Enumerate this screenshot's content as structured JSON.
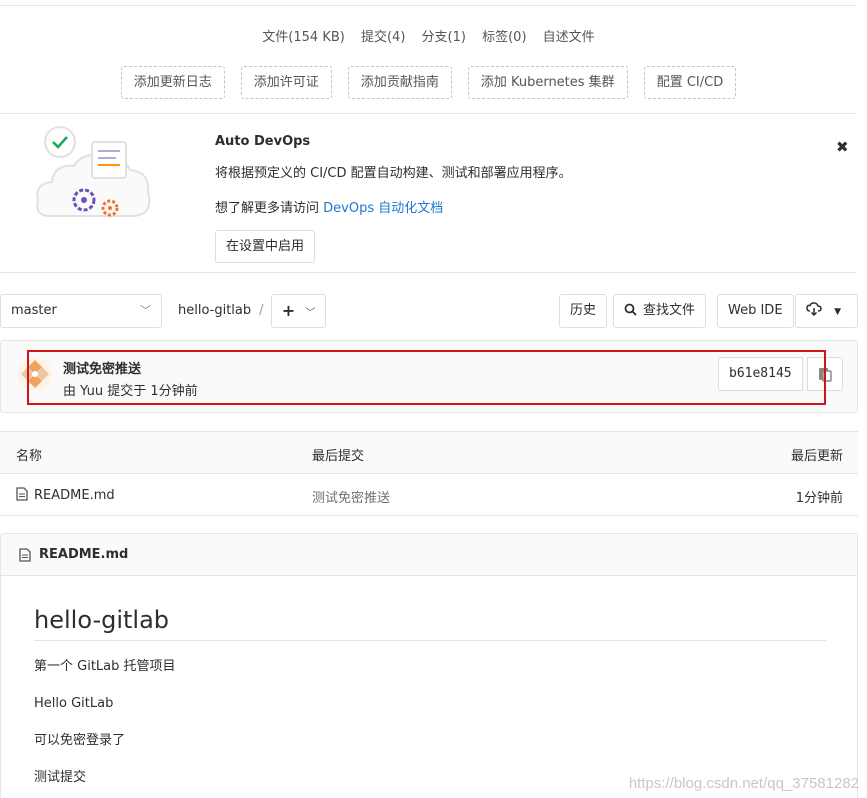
{
  "stats": {
    "files": "文件(154 KB)",
    "commits": "提交(4)",
    "branches": "分支(1)",
    "tags": "标签(0)",
    "readme": "自述文件"
  },
  "add_buttons": {
    "changelog": "添加更新日志",
    "license": "添加许可证",
    "contributing": "添加贡献指南",
    "kubernetes": "添加 Kubernetes 集群",
    "cicd": "配置 CI/CD"
  },
  "auto_devops": {
    "title": "Auto DevOps",
    "description": "将根据预定义的 CI/CD 配置自动构建、测试和部署应用程序。",
    "more_prefix": "想了解更多请访问 ",
    "more_link": "DevOps 自动化文档",
    "enable_button": "在设置中启用",
    "close_icon": "close-icon"
  },
  "tree": {
    "branch": "master",
    "project": "hello-gitlab",
    "separator": "/",
    "add_button": "+",
    "history": "历史",
    "find_file": "查找文件",
    "web_ide": "Web IDE"
  },
  "last_commit": {
    "title": "测试免密推送",
    "meta": "由 Yuu 提交于 1分钟前",
    "sha": "b61e8145",
    "highlight_color": "#d0151a"
  },
  "file_table": {
    "headers": [
      "名称",
      "最后提交",
      "最后更新"
    ],
    "rows": [
      {
        "name": "README.md",
        "commit": "测试免密推送",
        "updated": "1分钟前"
      }
    ]
  },
  "readme": {
    "filename": "README.md",
    "heading": "hello-gitlab",
    "paragraphs": [
      "第一个 GitLab 托管项目",
      "Hello GitLab",
      "可以免密登录了",
      "测试提交"
    ]
  },
  "watermark": "https://blog.csdn.net/qq_37581282",
  "colors": {
    "link": "#1f78d1",
    "border": "#e5e5e5",
    "panel": "#fafafa"
  }
}
